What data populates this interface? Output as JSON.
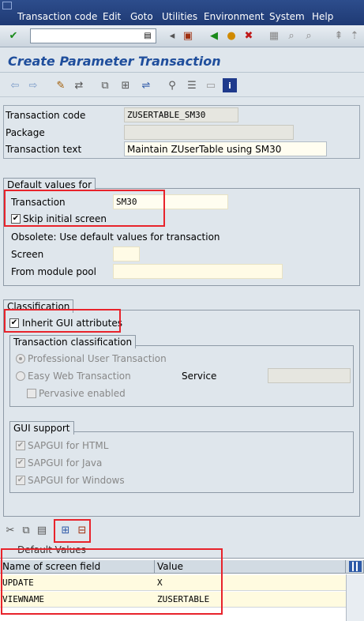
{
  "menubar": {
    "items": [
      "Transaction code",
      "Edit",
      "Goto",
      "Utilities",
      "Environment",
      "System",
      "Help"
    ]
  },
  "page": {
    "title": "Create Parameter Transaction"
  },
  "header_fields": {
    "transaction_code_label": "Transaction code",
    "transaction_code_value": "ZUSERTABLE_SM30",
    "package_label": "Package",
    "package_value": "",
    "transaction_text_label": "Transaction text",
    "transaction_text_value": "Maintain ZUserTable using SM30"
  },
  "default_values": {
    "group_label": "Default values for",
    "transaction_label": "Transaction",
    "transaction_value": "SM30",
    "skip_initial_screen_label": "Skip initial screen",
    "skip_initial_screen_checked": true,
    "obsolete_text": "Obsolete: Use default values for transaction",
    "screen_label": "Screen",
    "screen_value": "",
    "module_pool_label": "From module pool",
    "module_pool_value": ""
  },
  "classification": {
    "group_label": "Classification",
    "inherit_gui_label": "Inherit GUI attributes",
    "inherit_gui_checked": true,
    "tx_class_label": "Transaction classification",
    "professional_label": "Professional User Transaction",
    "easy_web_label": "Easy Web Transaction",
    "service_label": "Service",
    "service_value": "",
    "pervasive_label": "Pervasive enabled",
    "gui_support_label": "GUI support",
    "gui_html_label": "SAPGUI for HTML",
    "gui_java_label": "SAPGUI for Java",
    "gui_windows_label": "SAPGUI for Windows"
  },
  "default_values_table": {
    "caption": "Default Values",
    "col_name": "Name of screen field",
    "col_value": "Value",
    "rows": [
      {
        "name": "UPDATE",
        "value": "X"
      },
      {
        "name": "VIEWNAME",
        "value": "ZUSERTABLE"
      }
    ]
  },
  "colors": {
    "menubar": "#1f3a74",
    "title": "#1f4e9c",
    "highlight": "#e8232b"
  }
}
